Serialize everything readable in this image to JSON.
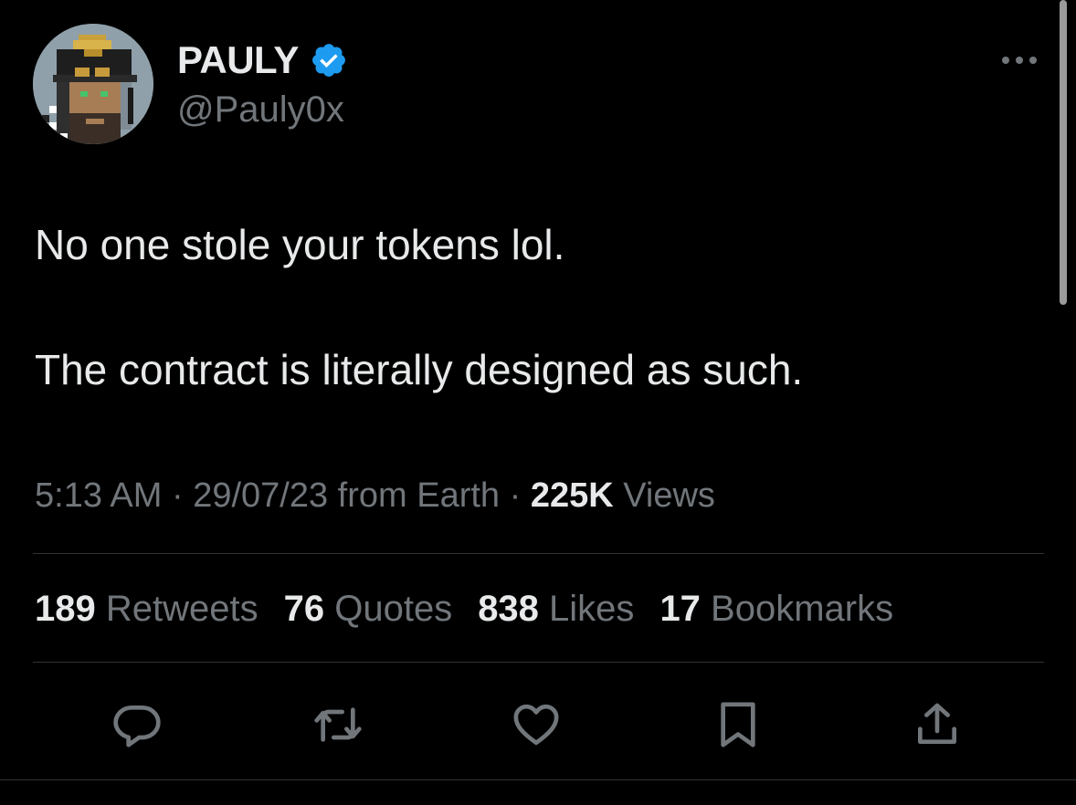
{
  "author": {
    "display_name": "PAULY",
    "handle": "@Pauly0x",
    "verified": true,
    "verified_color": "#1d9bf0"
  },
  "tweet": {
    "line1": "No one stole your tokens lol.",
    "line2": "The contract is literally designed as such."
  },
  "meta": {
    "time_date_source": "5:13 AM · 29/07/23 from Earth · ",
    "views_count": "225K",
    "views_label": " Views"
  },
  "stats": {
    "retweets_count": "189",
    "retweets_label": " Retweets",
    "quotes_count": "76",
    "quotes_label": " Quotes",
    "likes_count": "838",
    "likes_label": " Likes",
    "bookmarks_count": "17",
    "bookmarks_label": " Bookmarks"
  },
  "icons": {
    "more": "more-icon",
    "reply": "reply-icon",
    "retweet": "retweet-icon",
    "like": "heart-icon",
    "bookmark": "bookmark-icon",
    "share": "share-icon",
    "verified": "verified-badge-icon"
  },
  "colors": {
    "background": "#000000",
    "primary_text": "#e7e9ea",
    "secondary_text": "#71767b",
    "divider": "#2f3336"
  }
}
